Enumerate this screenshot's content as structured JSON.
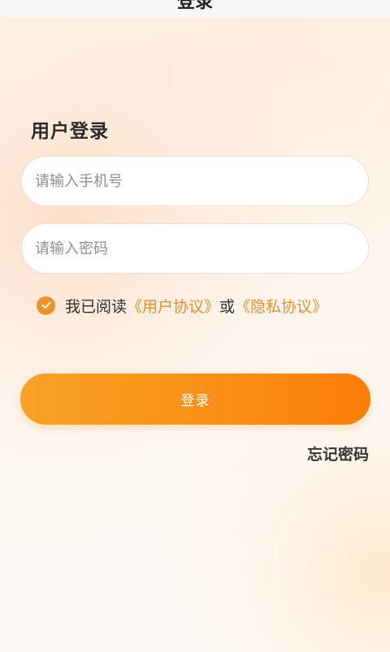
{
  "header": {
    "title": "登录"
  },
  "form": {
    "title": "用户登录",
    "phone_placeholder": "请输入手机号",
    "password_placeholder": "请输入密码"
  },
  "agreement": {
    "checked": true,
    "prefix": "我已阅读",
    "user_agreement": "《用户协议》",
    "joiner": "或",
    "privacy_policy": "《隐私协议》"
  },
  "actions": {
    "login_label": "登录",
    "forgot_password": "忘记密码"
  },
  "colors": {
    "accent": "#f0922b",
    "button_start": "#f7a326",
    "button_end": "#fb7e0a",
    "link": "#e0912f"
  },
  "icons": {
    "checkbox": "check-icon"
  }
}
